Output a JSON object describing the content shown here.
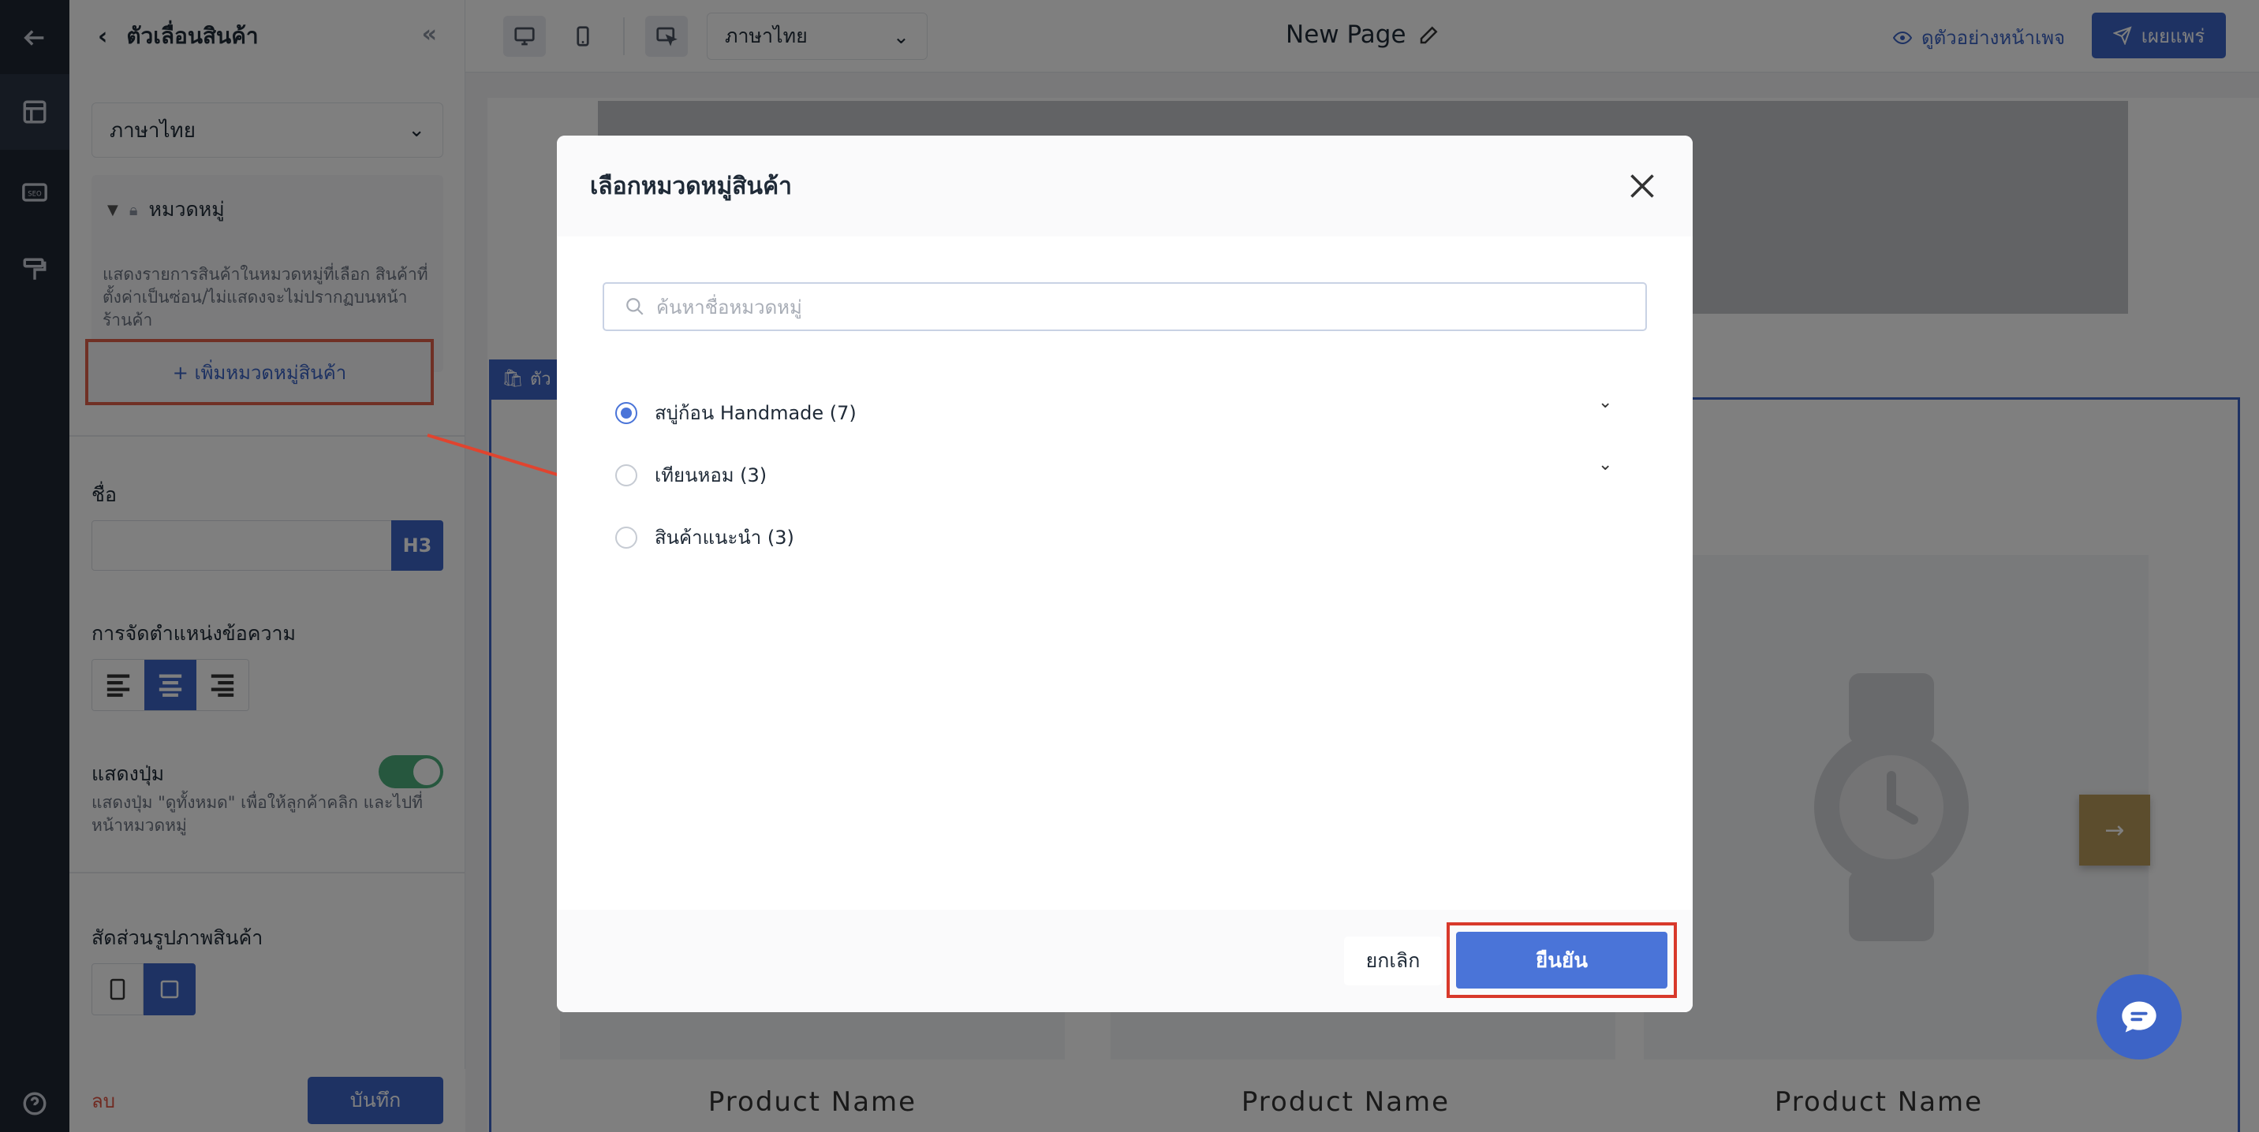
{
  "rail": {
    "items": [
      {
        "icon": "back-arrow-icon"
      },
      {
        "icon": "layout-icon"
      },
      {
        "icon": "seo-icon",
        "label": "SEO"
      },
      {
        "icon": "paint-roller-icon"
      },
      {
        "icon": "help-icon",
        "label": "?"
      }
    ]
  },
  "panel": {
    "title": "ตัวเลื่อนสินค้า",
    "language": "ภาษาไทย",
    "category_section_title": "หมวดหมู่",
    "category_desc": "แสดงรายการสินค้าในหมวดหมู่ที่เลือก สินค้าที่ตั้งค่าเป็นซ่อน/ไม่แสดงจะไม่ปรากฏบนหน้าร้านค้า",
    "add_category_label": "+ เพิ่มหมวดหมู่สินค้า",
    "name_label": "ชื่อ",
    "name_value": "",
    "heading_level": "H3",
    "text_align_label": "การจัดตำแหน่งข้อความ",
    "text_align_value": "center",
    "show_button_label": "แสดงปุ่ม",
    "show_button_on": true,
    "show_button_desc": "แสดงปุ่ม \"ดูทั้งหมด\" เพื่อให้ลูกค้าคลิก และไปที่หน้าหมวดหมู่",
    "image_ratio_label": "สัดส่วนรูปภาพสินค้า",
    "image_ratio_value": "square",
    "delete_label": "ลบ",
    "save_label": "บันทึก"
  },
  "topbar": {
    "language": "ภาษาไทย",
    "page_title": "New Page",
    "preview_label": "ดูตัวอย่างหน้าเพจ",
    "publish_label": "เผยแพร่"
  },
  "canvas": {
    "section_tag": "ตัว",
    "product_names": [
      "Product Name",
      "Product Name",
      "Product Name"
    ]
  },
  "modal": {
    "title": "เลือกหมวดหมู่สินค้า",
    "search_placeholder": "ค้นหาชื่อหมวดหมู่",
    "options": [
      {
        "label": "สบู่ก้อน Handmade (7)",
        "selected": true,
        "expandable": true
      },
      {
        "label": "เทียนหอม (3)",
        "selected": false,
        "expandable": true
      },
      {
        "label": "สินค้าแนะนำ (3)",
        "selected": false,
        "expandable": false
      }
    ],
    "cancel_label": "ยกเลิก",
    "confirm_label": "ยืนยัน"
  },
  "colors": {
    "accent": "#3d64c6",
    "highlight_red": "#d8392b",
    "toggle_on": "#4caf7d"
  }
}
